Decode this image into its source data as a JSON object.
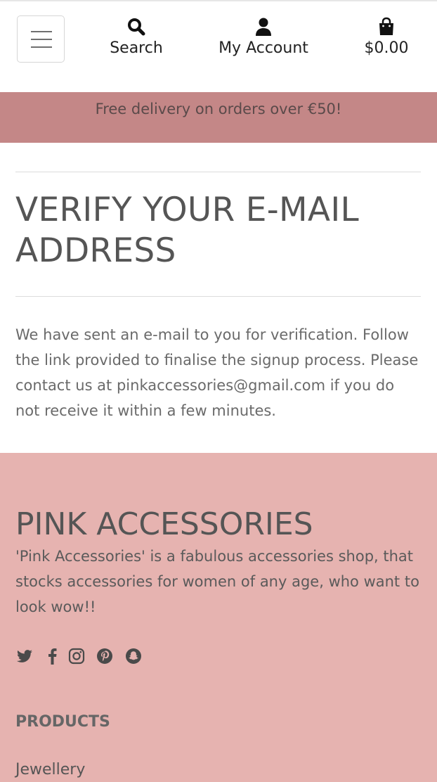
{
  "header": {
    "menu_icon": "hamburger-icon",
    "nav": [
      {
        "label": "Search",
        "icon": "search-icon"
      },
      {
        "label": "My Account",
        "icon": "user-icon"
      },
      {
        "label": "$0.00",
        "icon": "shopping-bag-icon"
      }
    ]
  },
  "banner": {
    "text": "Free delivery on orders over €50!"
  },
  "main": {
    "title": "VERIFY YOUR E-MAIL ADDRESS",
    "message": "We have sent an e-mail to you for verification. Follow the link provided to finalise the signup process. Please contact us at pinkaccessories@gmail.com if you do not receive it within a few minutes."
  },
  "footer": {
    "brand": "PINK ACCESSORIES",
    "about": "'Pink Accessories' is a fabulous accessories shop, that stocks accessories for women of any age, who want to look wow!!",
    "social_icons": [
      "twitter-icon",
      "facebook-icon",
      "instagram-icon",
      "pinterest-icon",
      "snapchat-icon"
    ],
    "products_heading": "PRODUCTS",
    "products_links": [
      "Jewellery"
    ]
  },
  "colors": {
    "banner_bg": "#c48787",
    "footer_bg": "#e6b3b0",
    "text": "#555555"
  }
}
